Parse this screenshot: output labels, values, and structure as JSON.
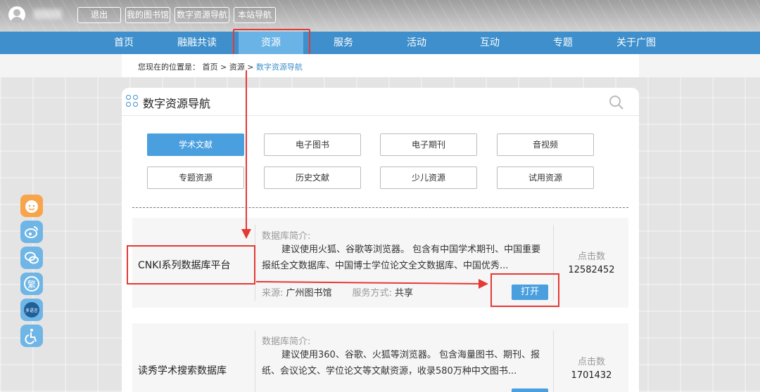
{
  "topbar": {
    "buttons": [
      "退出",
      "我的图书馆",
      "数字资源导航",
      "本站导航"
    ]
  },
  "nav": {
    "items": [
      "首页",
      "融融共读",
      "资源",
      "服务",
      "活动",
      "互动",
      "专题",
      "关于广图"
    ],
    "active_index": 2
  },
  "breadcrumb": {
    "prefix": "您现在的位置是：",
    "home": "首页",
    "sep": ">",
    "level1": "资源",
    "current": "数字资源导航"
  },
  "panel": {
    "title": "数字资源导航",
    "categories": [
      "学术文献",
      "电子图书",
      "电子期刊",
      "音视频",
      "专题资源",
      "历史文献",
      "少儿资源",
      "试用资源"
    ],
    "active_category": 0
  },
  "databases": [
    {
      "name": "CNKI系列数据库平台",
      "intro_label": "数据库简介:",
      "intro": "建议使用火狐、谷歌等浏览器。 包含有中国学术期刊、中国重要报纸全文数据库、中国博士学位论文全文数据库、中国优秀...",
      "source_label": "来源:",
      "source": "广州图书馆",
      "service_label": "服务方式:",
      "service": "共享",
      "clicks_label": "点击数",
      "clicks": "12582452",
      "open_label": "打开"
    },
    {
      "name": "读秀学术搜索数据库",
      "intro_label": "数据库简介:",
      "intro": "建议使用360、谷歌、火狐等浏览器。 包含海量图书、期刊、报纸、会议论文、学位论文等文献资源，收录580万种中文图书...",
      "clicks_label": "点击数",
      "clicks": "1701432"
    }
  ],
  "colors": {
    "nav": "#3e8fcb",
    "nav_active": "#6ab3e6",
    "button_blue": "#4a9fdf",
    "annotation_red": "#e53935"
  }
}
